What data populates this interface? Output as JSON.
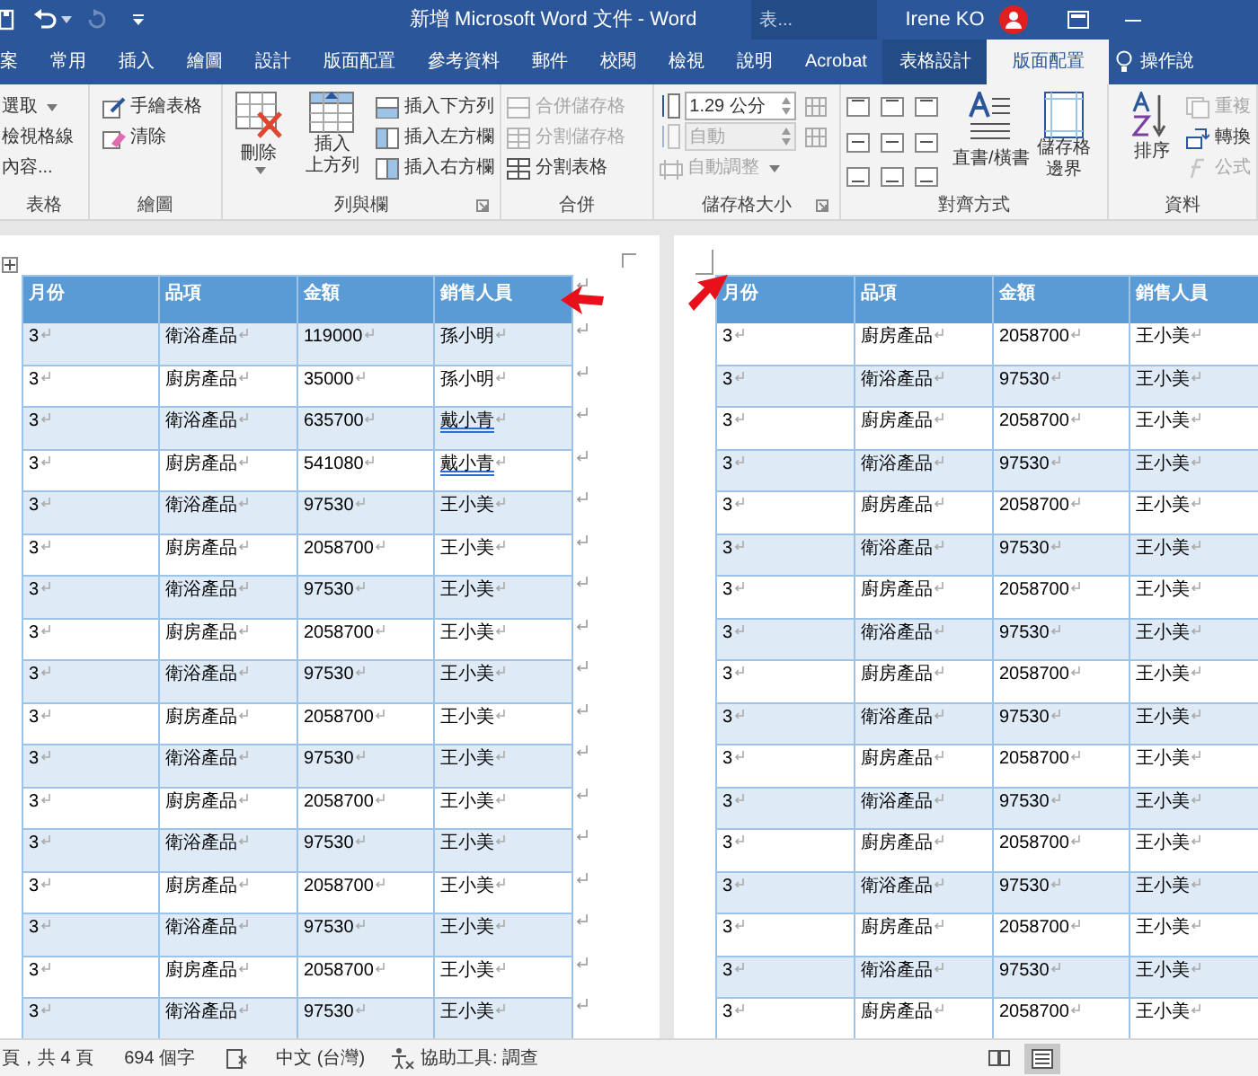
{
  "title_bar": {
    "title": "新增 Microsoft Word 文件 - Word",
    "context_label": "表...",
    "user_name": "Irene KO"
  },
  "tabs": [
    {
      "label": "案",
      "selected": false,
      "contextual": false
    },
    {
      "label": "常用",
      "selected": false,
      "contextual": false
    },
    {
      "label": "插入",
      "selected": false,
      "contextual": false
    },
    {
      "label": "繪圖",
      "selected": false,
      "contextual": false
    },
    {
      "label": "設計",
      "selected": false,
      "contextual": false
    },
    {
      "label": "版面配置",
      "selected": false,
      "contextual": false
    },
    {
      "label": "參考資料",
      "selected": false,
      "contextual": false
    },
    {
      "label": "郵件",
      "selected": false,
      "contextual": false
    },
    {
      "label": "校閱",
      "selected": false,
      "contextual": false
    },
    {
      "label": "檢視",
      "selected": false,
      "contextual": false
    },
    {
      "label": "說明",
      "selected": false,
      "contextual": false
    },
    {
      "label": "Acrobat",
      "selected": false,
      "contextual": false
    },
    {
      "label": "表格設計",
      "selected": false,
      "contextual": true
    },
    {
      "label": "版面配置",
      "selected": true,
      "contextual": true
    }
  ],
  "tell_me": "操作說",
  "ribbon": {
    "table_group": {
      "label": "表格",
      "select": {
        "label": "選取",
        "disabled": false
      },
      "view_gridlines": {
        "label": "檢視格線",
        "disabled": false
      },
      "properties": {
        "label": "內容...",
        "disabled": false
      }
    },
    "draw_group": {
      "label": "繪圖",
      "draw_table": {
        "label": "手繪表格",
        "disabled": false
      },
      "eraser": {
        "label": "清除",
        "disabled": false
      }
    },
    "rows_columns_group": {
      "label": "列與欄",
      "delete": {
        "label": "刪除",
        "disabled": false
      },
      "insert_above": {
        "label_lines": [
          "插入",
          "上方列"
        ],
        "disabled": false
      },
      "insert_below": {
        "label": "插入下方列",
        "disabled": false
      },
      "insert_left": {
        "label": "插入左方欄",
        "disabled": false
      },
      "insert_right": {
        "label": "插入右方欄",
        "disabled": false
      }
    },
    "merge_group": {
      "label": "合併",
      "merge_cells": {
        "label": "合併儲存格",
        "disabled": true
      },
      "split_cells": {
        "label": "分割儲存格",
        "disabled": true
      },
      "split_table": {
        "label": "分割表格",
        "disabled": false
      }
    },
    "cell_size_group": {
      "label": "儲存格大小",
      "height": {
        "value": "1.29 公分",
        "disabled": false
      },
      "width": {
        "value": "自動",
        "disabled": true
      },
      "autofit": {
        "label": "自動調整",
        "disabled": true
      }
    },
    "alignment_group": {
      "label": "對齊方式",
      "text_direction": {
        "label": "直書/橫書",
        "disabled": false
      },
      "cell_margins": {
        "label_lines": [
          "儲存格",
          "邊界"
        ],
        "disabled": false
      }
    },
    "data_group": {
      "label": "資料",
      "sort": {
        "label": "排序",
        "disabled": false
      },
      "repeat_header": {
        "label": "重複",
        "disabled": true
      },
      "convert": {
        "label": "轉換",
        "disabled": false
      },
      "formula": {
        "label": "公式",
        "disabled": true
      }
    }
  },
  "pages": [
    {
      "columns": [
        "月份",
        "品項",
        "金額",
        "銷售人員"
      ],
      "rows": [
        {
          "cells": [
            "3",
            "衛浴產品",
            "119000",
            "孫小明"
          ],
          "banded": true,
          "flagged": false
        },
        {
          "cells": [
            "3",
            "廚房產品",
            "35000",
            "孫小明"
          ],
          "banded": false,
          "flagged": false
        },
        {
          "cells": [
            "3",
            "衛浴產品",
            "635700",
            "戴小青"
          ],
          "banded": true,
          "flagged": true
        },
        {
          "cells": [
            "3",
            "廚房產品",
            "541080",
            "戴小青"
          ],
          "banded": false,
          "flagged": true
        },
        {
          "cells": [
            "3",
            "衛浴產品",
            "97530",
            "王小美"
          ],
          "banded": true,
          "flagged": false
        },
        {
          "cells": [
            "3",
            "廚房產品",
            "2058700",
            "王小美"
          ],
          "banded": false,
          "flagged": false
        },
        {
          "cells": [
            "3",
            "衛浴產品",
            "97530",
            "王小美"
          ],
          "banded": true,
          "flagged": false
        },
        {
          "cells": [
            "3",
            "廚房產品",
            "2058700",
            "王小美"
          ],
          "banded": false,
          "flagged": false
        },
        {
          "cells": [
            "3",
            "衛浴產品",
            "97530",
            "王小美"
          ],
          "banded": true,
          "flagged": false
        },
        {
          "cells": [
            "3",
            "廚房產品",
            "2058700",
            "王小美"
          ],
          "banded": false,
          "flagged": false
        },
        {
          "cells": [
            "3",
            "衛浴產品",
            "97530",
            "王小美"
          ],
          "banded": true,
          "flagged": false
        },
        {
          "cells": [
            "3",
            "廚房產品",
            "2058700",
            "王小美"
          ],
          "banded": false,
          "flagged": false
        },
        {
          "cells": [
            "3",
            "衛浴產品",
            "97530",
            "王小美"
          ],
          "banded": true,
          "flagged": false
        },
        {
          "cells": [
            "3",
            "廚房產品",
            "2058700",
            "王小美"
          ],
          "banded": false,
          "flagged": false
        },
        {
          "cells": [
            "3",
            "衛浴產品",
            "97530",
            "王小美"
          ],
          "banded": true,
          "flagged": false
        },
        {
          "cells": [
            "3",
            "廚房產品",
            "2058700",
            "王小美"
          ],
          "banded": false,
          "flagged": false
        },
        {
          "cells": [
            "3",
            "衛浴產品",
            "97530",
            "王小美"
          ],
          "banded": true,
          "flagged": false
        }
      ]
    },
    {
      "columns": [
        "月份",
        "品項",
        "金額",
        "銷售人員"
      ],
      "rows": [
        {
          "cells": [
            "3",
            "廚房產品",
            "2058700",
            "王小美"
          ],
          "banded": false,
          "flagged": false
        },
        {
          "cells": [
            "3",
            "衛浴產品",
            "97530",
            "王小美"
          ],
          "banded": true,
          "flagged": false
        },
        {
          "cells": [
            "3",
            "廚房產品",
            "2058700",
            "王小美"
          ],
          "banded": false,
          "flagged": false
        },
        {
          "cells": [
            "3",
            "衛浴產品",
            "97530",
            "王小美"
          ],
          "banded": true,
          "flagged": false
        },
        {
          "cells": [
            "3",
            "廚房產品",
            "2058700",
            "王小美"
          ],
          "banded": false,
          "flagged": false
        },
        {
          "cells": [
            "3",
            "衛浴產品",
            "97530",
            "王小美"
          ],
          "banded": true,
          "flagged": false
        },
        {
          "cells": [
            "3",
            "廚房產品",
            "2058700",
            "王小美"
          ],
          "banded": false,
          "flagged": false
        },
        {
          "cells": [
            "3",
            "衛浴產品",
            "97530",
            "王小美"
          ],
          "banded": true,
          "flagged": false
        },
        {
          "cells": [
            "3",
            "廚房產品",
            "2058700",
            "王小美"
          ],
          "banded": false,
          "flagged": false
        },
        {
          "cells": [
            "3",
            "衛浴產品",
            "97530",
            "王小美"
          ],
          "banded": true,
          "flagged": false
        },
        {
          "cells": [
            "3",
            "廚房產品",
            "2058700",
            "王小美"
          ],
          "banded": false,
          "flagged": false
        },
        {
          "cells": [
            "3",
            "衛浴產品",
            "97530",
            "王小美"
          ],
          "banded": true,
          "flagged": false
        },
        {
          "cells": [
            "3",
            "廚房產品",
            "2058700",
            "王小美"
          ],
          "banded": false,
          "flagged": false
        },
        {
          "cells": [
            "3",
            "衛浴產品",
            "97530",
            "王小美"
          ],
          "banded": true,
          "flagged": false
        },
        {
          "cells": [
            "3",
            "廚房產品",
            "2058700",
            "王小美"
          ],
          "banded": false,
          "flagged": false
        },
        {
          "cells": [
            "3",
            "衛浴產品",
            "97530",
            "王小美"
          ],
          "banded": true,
          "flagged": false
        },
        {
          "cells": [
            "3",
            "廚房產品",
            "2058700",
            "王小美"
          ],
          "banded": false,
          "flagged": false
        }
      ]
    }
  ],
  "status_bar": {
    "page": "頁，共 4 頁",
    "words": "694 個字",
    "language": "中文 (台灣)",
    "accessibility": "協助工具: 調查"
  }
}
